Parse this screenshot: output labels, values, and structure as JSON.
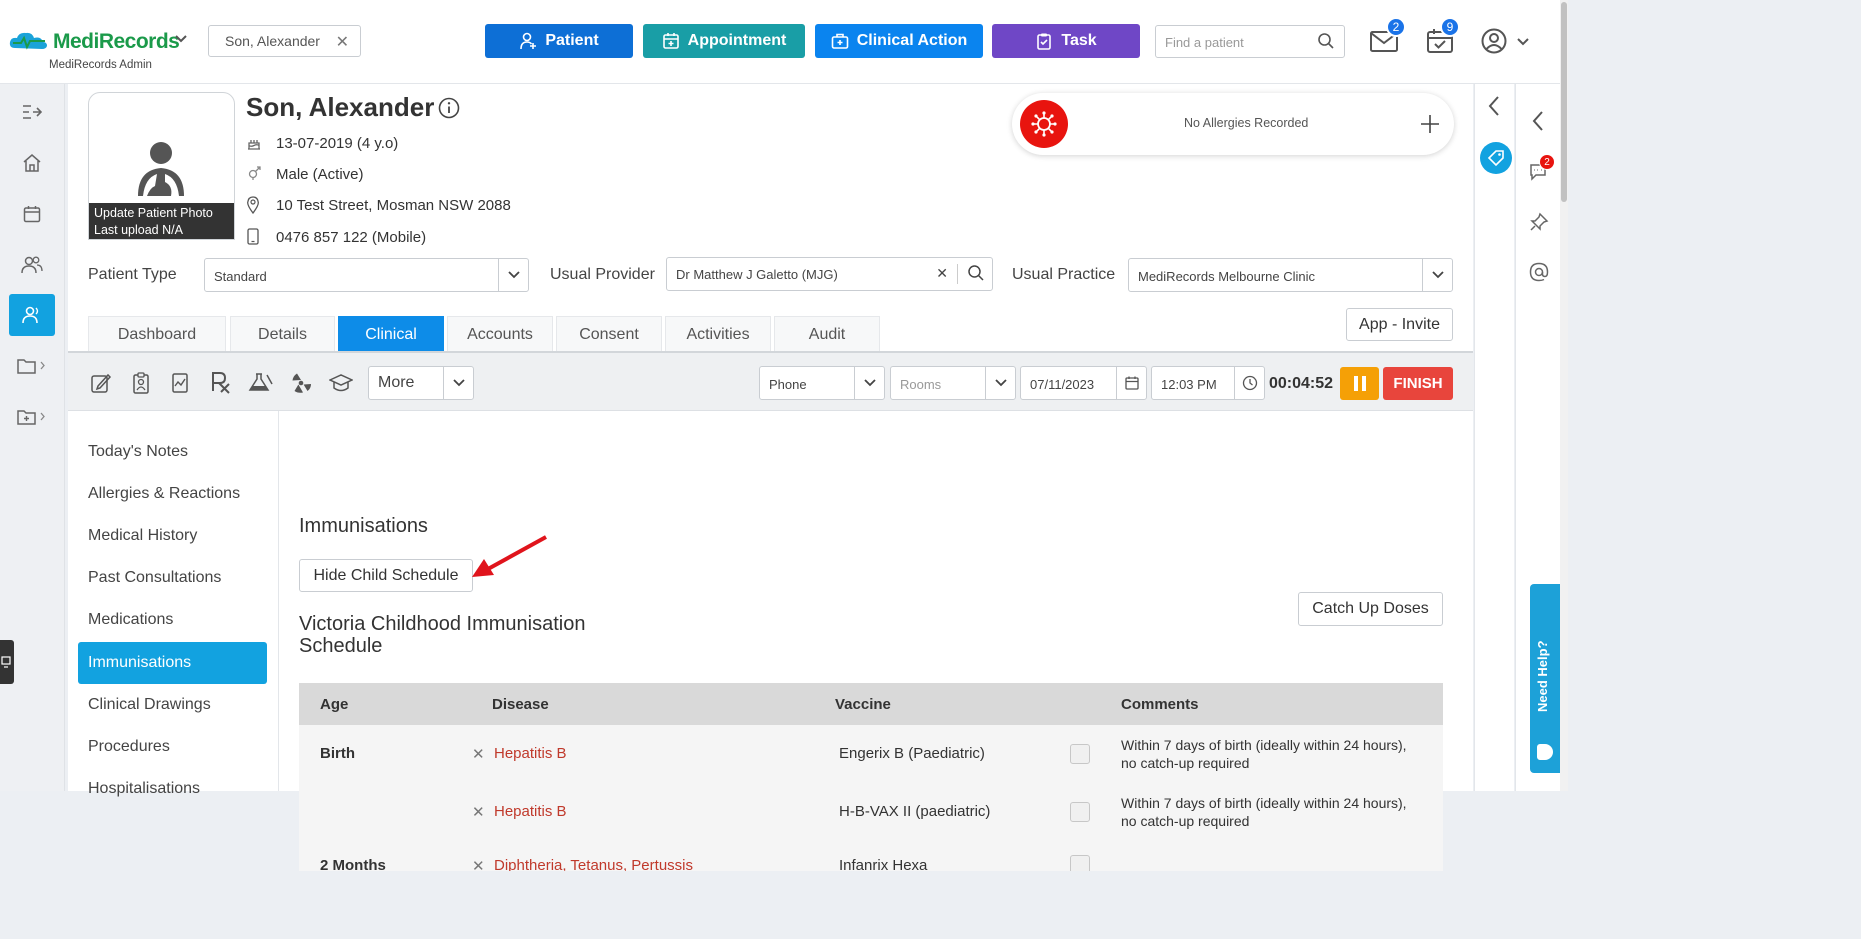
{
  "app": {
    "name": "MediRecords",
    "role": "MediRecords Admin"
  },
  "open_tab": {
    "label": "Son, Alexander"
  },
  "actions": [
    {
      "label": "Patient",
      "color": "#0d6fd6"
    },
    {
      "label": "Appointment",
      "color": "#199ea6"
    },
    {
      "label": "Clinical Action",
      "color": "#0a84ef"
    },
    {
      "label": "Task",
      "color": "#6f47c6"
    }
  ],
  "search": {
    "placeholder": "Find a patient"
  },
  "notifications": {
    "mail_count": "2",
    "tasks_count": "9"
  },
  "patient": {
    "name": "Son, Alexander",
    "dob": "13-07-2019 (4 y.o)",
    "gender": "Male (Active)",
    "address": "10 Test Street, Mosman NSW 2088",
    "phone": "0476 857 122 (Mobile)",
    "photo_caption_1": "Update Patient Photo",
    "photo_caption_2": "Last upload N/A"
  },
  "allergies": {
    "text": "No Allergies Recorded"
  },
  "fields": {
    "patient_type_label": "Patient Type",
    "patient_type_value": "Standard",
    "usual_provider_label": "Usual Provider",
    "usual_provider_value": "Dr Matthew J Galetto (MJG)",
    "usual_practice_label": "Usual Practice",
    "usual_practice_value": "MediRecords Melbourne Clinic"
  },
  "tabs": [
    "Dashboard",
    "Details",
    "Clinical",
    "Accounts",
    "Consent",
    "Activities",
    "Audit"
  ],
  "active_tab": "Clinical",
  "app_invite": "App - Invite",
  "toolbar": {
    "more": "More",
    "contact_type": "Phone",
    "rooms_placeholder": "Rooms",
    "date": "07/11/2023",
    "time": "12:03 PM",
    "timer": "00:04:52",
    "finish": "FINISH"
  },
  "nav": [
    "Today's Notes",
    "Allergies & Reactions",
    "Medical History",
    "Past Consultations",
    "Medications",
    "Immunisations",
    "Clinical Drawings",
    "Procedures",
    "Hospitalisations"
  ],
  "active_nav": "Immunisations",
  "immunisations": {
    "heading": "Immunisations",
    "hide_button": "Hide Child Schedule",
    "schedule_title_1": "Victoria Childhood Immunisation",
    "schedule_title_2": "Schedule",
    "catch_up": "Catch Up Doses",
    "columns": [
      "Age",
      "Disease",
      "Vaccine",
      "Comments"
    ],
    "rows": [
      {
        "age": "Birth",
        "disease": "Hepatitis B",
        "vaccine": "Engerix B (Paediatric)",
        "comment_1": "Within 7 days of birth (ideally within 24 hours),",
        "comment_2": "no catch-up required"
      },
      {
        "age": "",
        "disease": "Hepatitis B",
        "vaccine": "H-B-VAX II (paediatric)",
        "comment_1": "Within 7 days of birth (ideally within 24 hours),",
        "comment_2": "no catch-up required"
      },
      {
        "age": "2 Months",
        "disease": "Diphtheria, Tetanus, Pertussis",
        "vaccine": "Infanrix Hexa",
        "comment_1": "",
        "comment_2": ""
      }
    ]
  },
  "help": {
    "label": "Need Help?"
  },
  "right_rail": {
    "chat_badge": "2"
  }
}
